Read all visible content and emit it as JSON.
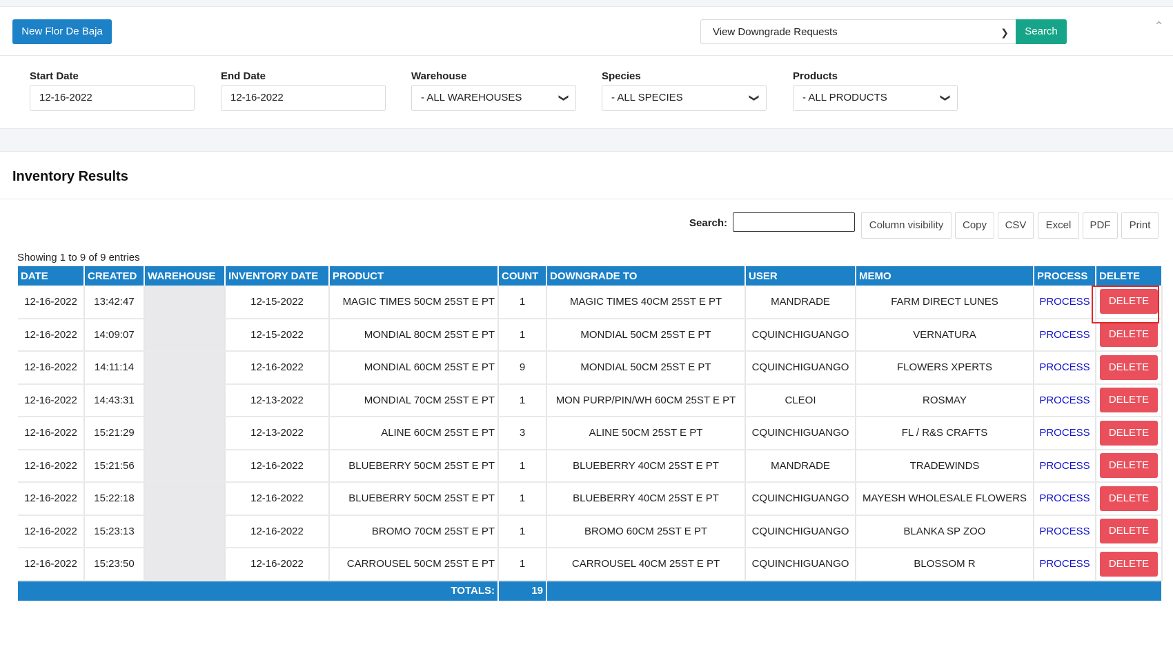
{
  "toolbar": {
    "new_label": "New Flor De Baja",
    "view_select_value": "View Downgrade Requests",
    "search_label": "Search"
  },
  "filters": {
    "start_date": {
      "label": "Start Date",
      "value": "12-16-2022"
    },
    "end_date": {
      "label": "End Date",
      "value": "12-16-2022"
    },
    "warehouse": {
      "label": "Warehouse",
      "value": "- ALL WAREHOUSES"
    },
    "species": {
      "label": "Species",
      "value": "- ALL SPECIES"
    },
    "products": {
      "label": "Products",
      "value": "- ALL PRODUCTS"
    }
  },
  "results": {
    "title": "Inventory Results",
    "search_label": "Search:",
    "buttons": [
      "Column visibility",
      "Copy",
      "CSV",
      "Excel",
      "PDF",
      "Print"
    ],
    "showing": "Showing 1 to 9 of 9 entries",
    "columns": [
      "DATE",
      "CREATED",
      "WAREHOUSE",
      "INVENTORY DATE",
      "PRODUCT",
      "COUNT",
      "DOWNGRADE TO",
      "USER",
      "MEMO",
      "PROCESS",
      "DELETE"
    ],
    "rows": [
      {
        "date": "12-16-2022",
        "created": "13:42:47",
        "warehouse": "",
        "inv_date": "12-15-2022",
        "product": "MAGIC TIMES 50CM 25ST E PT",
        "count": "1",
        "downgrade": "MAGIC TIMES 40CM 25ST E PT",
        "user": "MANDRADE",
        "memo": "FARM DIRECT LUNES",
        "process": "PROCESS",
        "delete": "DELETE"
      },
      {
        "date": "12-16-2022",
        "created": "14:09:07",
        "warehouse": "",
        "inv_date": "12-15-2022",
        "product": "MONDIAL 80CM 25ST E PT",
        "count": "1",
        "downgrade": "MONDIAL 50CM 25ST E PT",
        "user": "CQUINCHIGUANGO",
        "memo": "VERNATURA",
        "process": "PROCESS",
        "delete": "DELETE"
      },
      {
        "date": "12-16-2022",
        "created": "14:11:14",
        "warehouse": "",
        "inv_date": "12-16-2022",
        "product": "MONDIAL 60CM 25ST E PT",
        "count": "9",
        "downgrade": "MONDIAL 50CM 25ST E PT",
        "user": "CQUINCHIGUANGO",
        "memo": "FLOWERS XPERTS",
        "process": "PROCESS",
        "delete": "DELETE"
      },
      {
        "date": "12-16-2022",
        "created": "14:43:31",
        "warehouse": "",
        "inv_date": "12-13-2022",
        "product": "MONDIAL 70CM 25ST E PT",
        "count": "1",
        "downgrade": "MON PURP/PIN/WH 60CM 25ST E PT",
        "user": "CLEOI",
        "memo": "ROSMAY",
        "process": "PROCESS",
        "delete": "DELETE"
      },
      {
        "date": "12-16-2022",
        "created": "15:21:29",
        "warehouse": "",
        "inv_date": "12-13-2022",
        "product": "ALINE 60CM 25ST E PT",
        "count": "3",
        "downgrade": "ALINE 50CM 25ST E PT",
        "user": "CQUINCHIGUANGO",
        "memo": "FL / R&S CRAFTS",
        "process": "PROCESS",
        "delete": "DELETE"
      },
      {
        "date": "12-16-2022",
        "created": "15:21:56",
        "warehouse": "",
        "inv_date": "12-16-2022",
        "product": "BLUEBERRY 50CM 25ST E PT",
        "count": "1",
        "downgrade": "BLUEBERRY 40CM 25ST E PT",
        "user": "MANDRADE",
        "memo": "TRADEWINDS",
        "process": "PROCESS",
        "delete": "DELETE"
      },
      {
        "date": "12-16-2022",
        "created": "15:22:18",
        "warehouse": "",
        "inv_date": "12-16-2022",
        "product": "BLUEBERRY 50CM 25ST E PT",
        "count": "1",
        "downgrade": "BLUEBERRY 40CM 25ST E PT",
        "user": "CQUINCHIGUANGO",
        "memo": "MAYESH WHOLESALE FLOWERS",
        "process": "PROCESS",
        "delete": "DELETE"
      },
      {
        "date": "12-16-2022",
        "created": "15:23:13",
        "warehouse": "",
        "inv_date": "12-16-2022",
        "product": "BROMO 70CM 25ST E PT",
        "count": "1",
        "downgrade": "BROMO 60CM 25ST E PT",
        "user": "CQUINCHIGUANGO",
        "memo": "BLANKA SP ZOO",
        "process": "PROCESS",
        "delete": "DELETE"
      },
      {
        "date": "12-16-2022",
        "created": "15:23:50",
        "warehouse": "",
        "inv_date": "12-16-2022",
        "product": "CARROUSEL 50CM 25ST E PT",
        "count": "1",
        "downgrade": "CARROUSEL 40CM 25ST E PT",
        "user": "CQUINCHIGUANGO",
        "memo": "BLOSSOM R",
        "process": "PROCESS",
        "delete": "DELETE"
      }
    ],
    "totals_label": "TOTALS:",
    "totals_count": "19"
  },
  "colors": {
    "primary_blue": "#1c81c6",
    "search_green": "#17a589",
    "delete_red": "#e9505c",
    "process_link": "#1010cc"
  }
}
